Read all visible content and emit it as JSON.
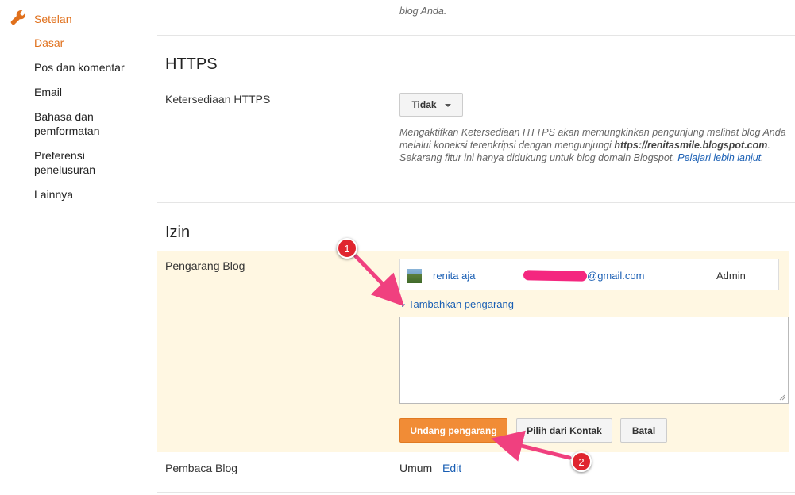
{
  "sidebar": {
    "header": "Setelan",
    "items": [
      {
        "label": "Dasar",
        "active": true
      },
      {
        "label": "Pos dan komentar"
      },
      {
        "label": "Email"
      },
      {
        "label": "Bahasa dan pemformatan"
      },
      {
        "label": "Preferensi penelusuran"
      },
      {
        "label": "Lainnya"
      }
    ]
  },
  "top_desc": "blog Anda.",
  "https": {
    "title": "HTTPS",
    "label": "Ketersediaan HTTPS",
    "select_value": "Tidak",
    "desc_pre": "Mengaktifkan Ketersediaan HTTPS akan memungkinkan pengunjung melihat blog Anda melalui koneksi terenkripsi dengan mengunjungi ",
    "desc_url": "https://renitasmile.blogspot.com",
    "desc_post": ". Sekarang fitur ini hanya didukung untuk blog domain Blogspot. ",
    "desc_link": "Pelajari lebih lanjut",
    "desc_end": "."
  },
  "permissions": {
    "title": "Izin",
    "authors_label": "Pengarang Blog",
    "author": {
      "name": "renita aja",
      "email": "@gmail.com",
      "role": "Admin"
    },
    "add_author": "+ Tambahkan pengarang",
    "invite_button": "Undang pengarang",
    "contacts_button": "Pilih dari Kontak",
    "cancel_button": "Batal",
    "readers_label": "Pembaca Blog",
    "readers_value": "Umum",
    "readers_edit": "Edit"
  },
  "annotations": {
    "marker1": "1",
    "marker2": "2"
  },
  "colors": {
    "accent": "#e0701c",
    "link": "#1a5fb4",
    "permission_bg": "#fff7e2",
    "primary_button": "#f18c36",
    "marker": "#e0252f"
  }
}
